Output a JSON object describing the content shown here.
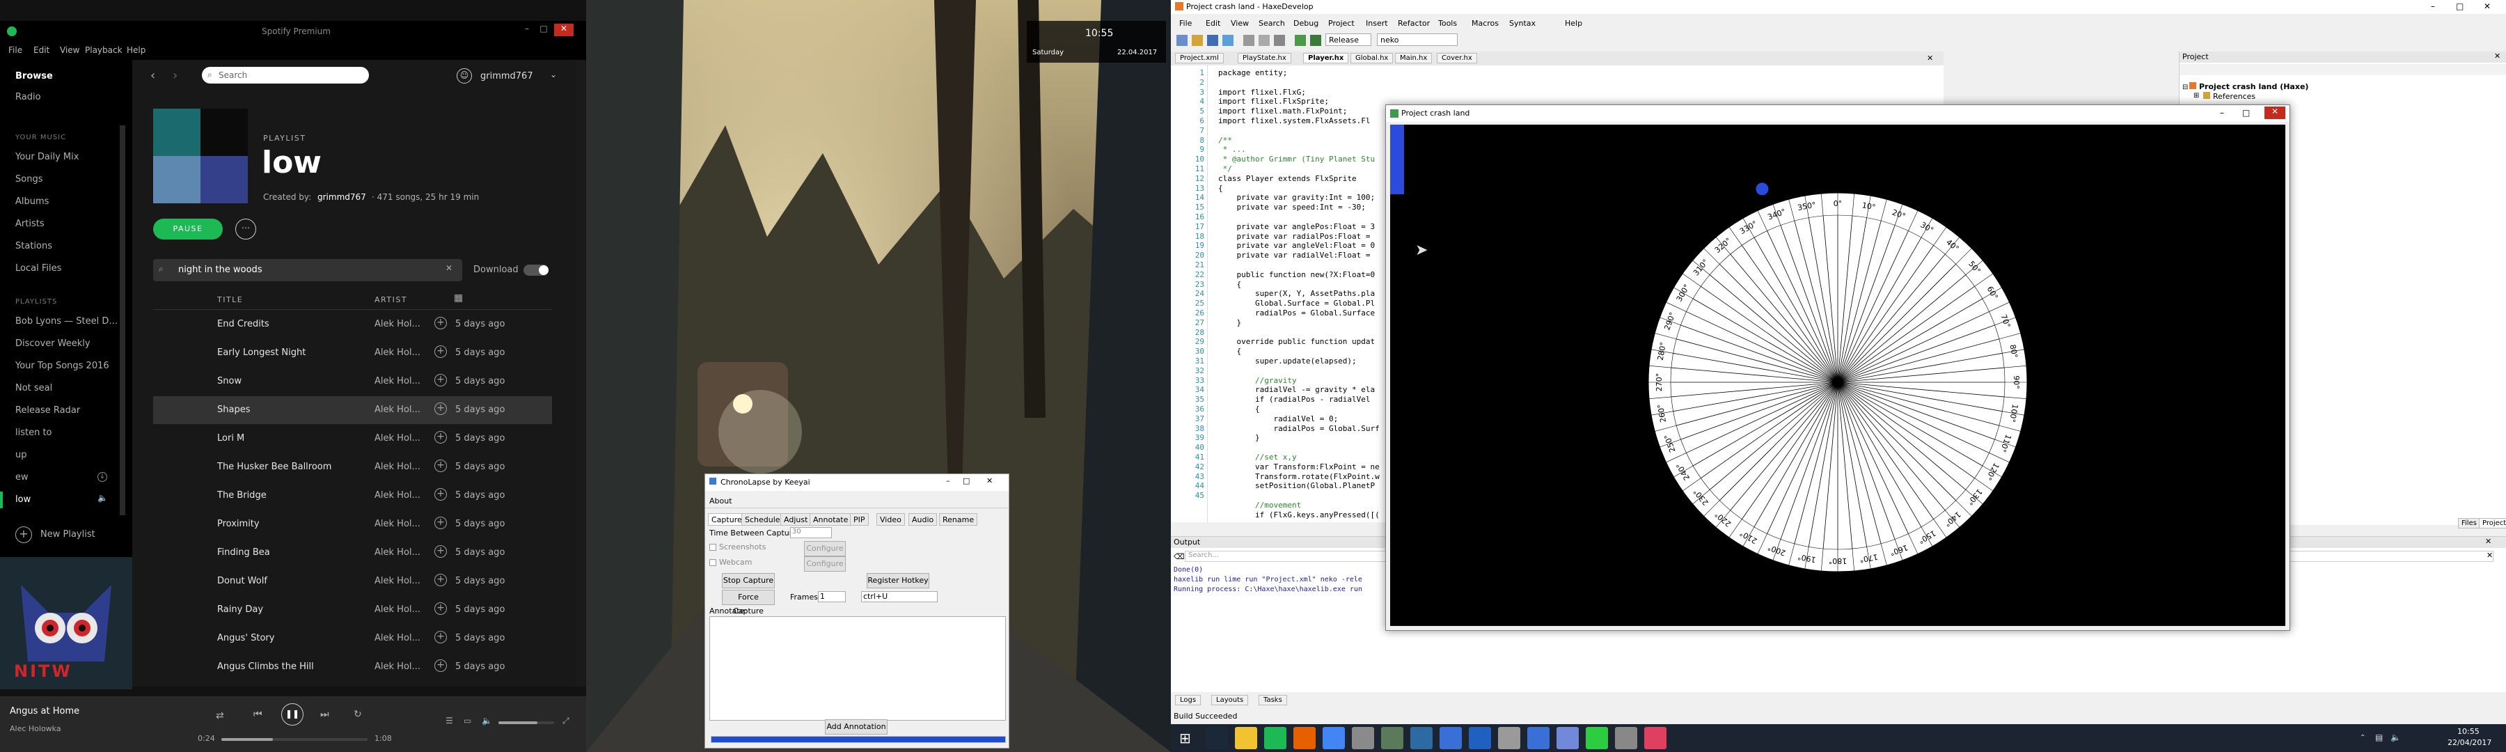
{
  "spotify": {
    "title": "Spotify Premium",
    "menu": [
      "File",
      "Edit",
      "View",
      "Playback",
      "Help"
    ],
    "search_placeholder": "Search",
    "user": "grimmd767",
    "nav": [
      "Browse",
      "Radio"
    ],
    "library_heading": "YOUR MUSIC",
    "library": [
      "Your Daily Mix",
      "Songs",
      "Albums",
      "Artists",
      "Stations",
      "Local Files"
    ],
    "playlists_heading": "PLAYLISTS",
    "playlists": [
      "Bob Lyons — Steel D…",
      "Discover Weekly",
      "Your Top Songs 2016",
      "Not seal",
      "Release Radar",
      "listen to",
      "up",
      "ew",
      "low"
    ],
    "new_playlist": "New Playlist",
    "playlist_kind": "PLAYLIST",
    "playlist_name": "low",
    "created_by_prefix": "Created by:",
    "created_by_user": "grimmd767",
    "playlist_meta": "· 471 songs, 25 hr 19 min",
    "pause_label": "PAUSE",
    "filter_value": "night in the woods",
    "download_label": "Download",
    "col_title": "TITLE",
    "col_artist": "ARTIST",
    "tracks": [
      {
        "title": "End Credits",
        "artist": "Alek Hol...",
        "added": "5 days ago"
      },
      {
        "title": "Early Longest Night",
        "artist": "Alek Hol...",
        "added": "5 days ago"
      },
      {
        "title": "Snow",
        "artist": "Alek Hol...",
        "added": "5 days ago"
      },
      {
        "title": "Shapes",
        "artist": "Alek Hol...",
        "added": "5 days ago"
      },
      {
        "title": "Lori M",
        "artist": "Alek Hol...",
        "added": "5 days ago"
      },
      {
        "title": "The Husker Bee Ballroom",
        "artist": "Alek Hol...",
        "added": "5 days ago"
      },
      {
        "title": "The Bridge",
        "artist": "Alek Hol...",
        "added": "5 days ago"
      },
      {
        "title": "Proximity",
        "artist": "Alek Hol...",
        "added": "5 days ago"
      },
      {
        "title": "Finding Bea",
        "artist": "Alek Hol...",
        "added": "5 days ago"
      },
      {
        "title": "Donut Wolf",
        "artist": "Alek Hol...",
        "added": "5 days ago"
      },
      {
        "title": "Rainy Day",
        "artist": "Alek Hol...",
        "added": "5 days ago"
      },
      {
        "title": "Angus' Story",
        "artist": "Alek Hol...",
        "added": "5 days ago"
      },
      {
        "title": "Angus Climbs the Hill",
        "artist": "Alek Hol...",
        "added": "5 days ago"
      }
    ],
    "cover_text": "NITW",
    "now_playing_title": "Angus at Home",
    "now_playing_artist": "Alec Holowka",
    "elapsed": "0:24",
    "duration": "1:08",
    "progress_fraction": 0.35,
    "volume_fraction": 0.7,
    "accent": "#1db954"
  },
  "clock": {
    "time": "10:55",
    "day": "Saturday",
    "date": "22.04.2017"
  },
  "chronolapse": {
    "title": "ChronoLapse by Keeyai",
    "menu": "About",
    "tabs": [
      "Capture",
      "Schedule",
      "Adjust",
      "Annotate",
      "PIP",
      "Video",
      "Audio",
      "Rename"
    ],
    "time_between_label": "Time Between Captures:",
    "time_between_value": "30",
    "screenshots_label": "Screenshots",
    "webcam_label": "Webcam",
    "configure_label": "Configure",
    "stop_capture": "Stop Capture",
    "force_capture": "Force Capture",
    "frames_label": "Frames:",
    "frames_value": "1",
    "register_hotkey": "Register Hotkey",
    "hotkey_value": "ctrl+U",
    "annotate_label": "Annotate:",
    "add_annotation": "Add Annotation",
    "progress_fraction": 1.0
  },
  "haxe": {
    "title": "Project crash land - HaxeDevelop",
    "menu": [
      "File",
      "Edit",
      "View",
      "Search",
      "Debug",
      "Project",
      "Insert",
      "Refactor",
      "Tools",
      "Macros",
      "Syntax",
      "Help"
    ],
    "build_config": "Release",
    "target": "neko",
    "tabs": [
      "Project.xml",
      "PlayState.hx",
      "Player.hx",
      "Global.hx",
      "Main.hx",
      "Cover.hx"
    ],
    "active_tab": "Player.hx",
    "line_numbers": [
      "1",
      "2",
      "3",
      "4",
      "5",
      "6",
      "7",
      "8",
      "9",
      "10",
      "11",
      "12",
      "13",
      "14",
      "15",
      "16",
      "17",
      "18",
      "19",
      "20",
      "21",
      "22",
      "23",
      "24",
      "25",
      "26",
      "27",
      "28",
      "29",
      "30",
      "31",
      "32",
      "33",
      "34",
      "35",
      "36",
      "37",
      "38",
      "39",
      "40",
      "41",
      "42",
      "43",
      "44",
      "45"
    ],
    "code": [
      "package entity;",
      "",
      "import flixel.FlxG;",
      "import flixel.FlxSprite;",
      "import flixel.math.FlxPoint;",
      "import flixel.system.FlxAssets.Fl",
      "",
      "/**",
      " * ...",
      " * @author Grimmr (Tiny Planet Stu",
      " */",
      "class Player extends FlxSprite",
      "{",
      "    private var gravity:Int = 100;",
      "    private var speed:Int = -30;",
      "",
      "    private var anglePos:Float = 3",
      "    private var radialPos:Float = ",
      "    private var angleVel:Float = 0",
      "    private var radialVel:Float = ",
      "",
      "    public function new(?X:Float=0",
      "    {",
      "        super(X, Y, AssetPaths.pla",
      "        Global.Surface = Global.Pl",
      "        radialPos = Global.Surface",
      "    }",
      "",
      "    override public function updat",
      "    {",
      "        super.update(elapsed);",
      "",
      "        //gravity",
      "        radialVel -= gravity * ela",
      "        if (radialPos - radialVel",
      "        {",
      "            radialVel = 0;",
      "            radialPos = Global.Surf",
      "        }",
      "",
      "        //set x,y",
      "        var Transform:FlxPoint = ne",
      "        Transform.rotate(FlxPoint.w",
      "        setPosition(Global.PlanetP",
      "",
      "        //movement",
      "        if (FlxG.keys.anyPressed([("
    ],
    "project_panel_title": "Project",
    "project_root": "Project crash land (Haxe)",
    "project_child": "References",
    "panel_tabs": [
      "Files",
      "Project"
    ],
    "output_title": "Output",
    "output_search": "Search...",
    "output_lines": [
      "Done(0)",
      "haxelib run lime run \"Project.xml\" neko -rele",
      "Running process: C:\\Haxe\\haxe\\haxelib.exe run"
    ],
    "bottom_tabs": [
      "Logs",
      "Layouts",
      "Tasks"
    ],
    "status": "Build Succeeded"
  },
  "game": {
    "title": "Project crash land",
    "dial_labels": [
      "0°",
      "10°",
      "20°",
      "30°",
      "40°",
      "50°",
      "60°",
      "70°",
      "80°",
      "90°",
      "100°",
      "110°",
      "120°",
      "130°",
      "140°",
      "150°",
      "160°",
      "170°",
      "180°",
      "190°",
      "200°",
      "210°",
      "220°",
      "230°",
      "240°",
      "250°",
      "260°",
      "270°",
      "280°",
      "290°",
      "300°",
      "310°",
      "320°",
      "330°",
      "340°",
      "350°"
    ],
    "player_angle_deg": 357
  },
  "taskbar": {
    "time": "10:55",
    "date": "22/04/2017",
    "apps": [
      "steam",
      "file-explorer",
      "spotify",
      "firefox",
      "chrome",
      "package",
      "monitor",
      "editor",
      "shield",
      "clock",
      "files",
      "store",
      "discord",
      "bubble",
      "game",
      "colors"
    ]
  }
}
